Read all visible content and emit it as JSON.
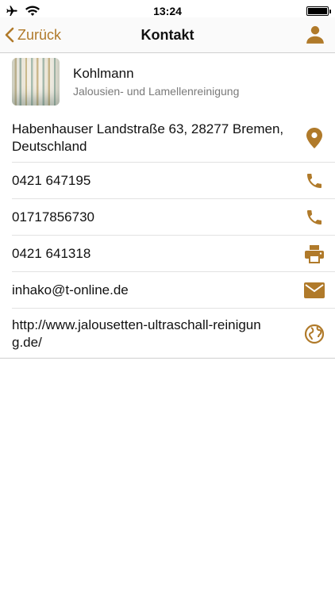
{
  "status_bar": {
    "time": "13:24"
  },
  "nav": {
    "back_label": "Zurück",
    "title": "Kontakt"
  },
  "contact": {
    "name": "Kohlmann",
    "subtitle": "Jalousien- und Lamellenreinigung"
  },
  "rows": [
    {
      "label": "Habenhauser Landstraße 63, 28277 Bremen, Deutschland",
      "icon": "location-pin-icon"
    },
    {
      "label": "0421 647195",
      "icon": "phone-icon"
    },
    {
      "label": "01717856730",
      "icon": "phone-icon"
    },
    {
      "label": "0421 641318",
      "icon": "printer-icon"
    },
    {
      "label": "inhako@t-online.de",
      "icon": "mail-icon"
    },
    {
      "label": "http://www.jalousetten-ultraschall-reinigung.de/",
      "icon": "globe-icon"
    }
  ],
  "colors": {
    "accent": "#b07a2a",
    "divider": "#e2e2e2",
    "subtitle": "#7a7a7a"
  }
}
